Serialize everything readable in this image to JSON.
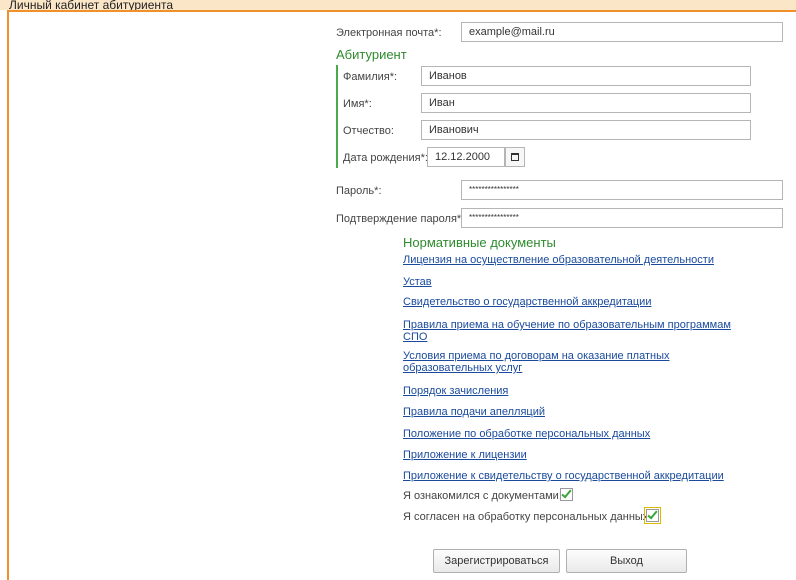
{
  "window": {
    "title": "Личный кабинет абитуриента"
  },
  "email": {
    "label": "Электронная почта*:",
    "value": "example@mail.ru"
  },
  "applicant": {
    "heading": "Абитуриент",
    "last_name": {
      "label": "Фамилия*:",
      "value": "Иванов"
    },
    "first_name": {
      "label": "Имя*:",
      "value": "Иван"
    },
    "middle_name": {
      "label": "Отчество:",
      "value": "Иванович"
    },
    "birth_date": {
      "label": "Дата рождения*:",
      "value": "12.12.2000"
    }
  },
  "password": {
    "label": "Пароль*:",
    "value": "****************"
  },
  "password_confirm": {
    "label": "Подтверждение пароля*:",
    "value": "****************"
  },
  "documents": {
    "heading": "Нормативные документы",
    "links": [
      "Лицензия на осуществление образовательной деятельности",
      "Устав",
      "Свидетельство о государственной аккредитации",
      "Правила приема на обучение по образовательным программам СПО",
      "Условия приема по договорам на оказание платных образовательных услуг",
      "Порядок зачисления",
      "Правила подачи апелляций",
      "Положение по обработке персональных данных",
      "Приложение к лицензии",
      "Приложение к свидетельству о государственной аккредитации"
    ]
  },
  "agreements": {
    "docs_ack": {
      "label": "Я ознакомился с документами:",
      "checked": true
    },
    "personal_data": {
      "label": "Я согласен на обработку персональных данных:",
      "checked": true
    }
  },
  "actions": {
    "register": "Зарегистрироваться",
    "exit": "Выход"
  },
  "colors": {
    "accent_frame": "#f0902a",
    "section_green": "#2e8b2e",
    "link_blue": "#1a4a9c",
    "check_green": "#3aa33a"
  }
}
